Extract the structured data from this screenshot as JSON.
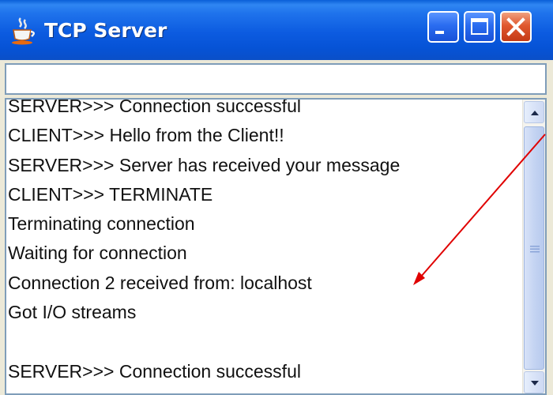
{
  "window": {
    "title": "TCP Server",
    "icon": "java-cup-icon",
    "controls": {
      "minimize_icon": "minimize-icon",
      "maximize_icon": "maximize-icon",
      "close_icon": "close-icon"
    }
  },
  "input": {
    "value": ""
  },
  "log": {
    "lines": [
      "SERVER>>> Connection successful",
      "CLIENT>>> Hello from the Client!!",
      "SERVER>>> Server has received your message",
      "CLIENT>>> TERMINATE",
      "Terminating connection",
      "Waiting for connection",
      "Connection 2 received from: localhost",
      "Got I/O streams",
      "",
      "SERVER>>> Connection successful"
    ]
  },
  "annotation": {
    "arrow_color": "#e00000"
  },
  "colors": {
    "titlebar": "#0c5be0",
    "close_button": "#e0582e",
    "field_border": "#7f9db9"
  }
}
